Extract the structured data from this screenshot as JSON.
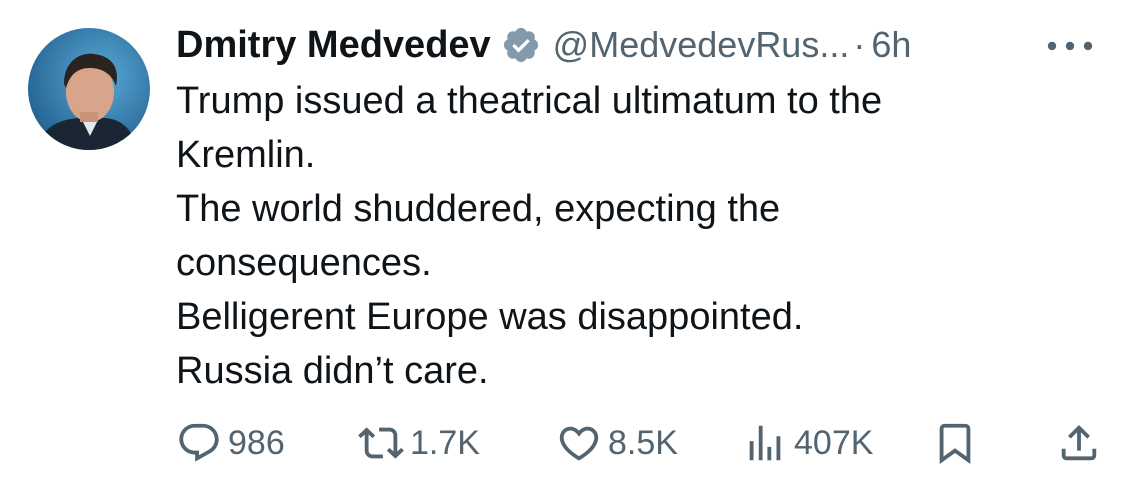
{
  "author": {
    "name": "Dmitry Medvedev",
    "handle": "@MedvedevRus...",
    "separator": "·",
    "time": "6h"
  },
  "tweet": {
    "lines": [
      "Trump issued a theatrical ultimatum to the",
      "Kremlin.",
      "The world shuddered, expecting the",
      "consequences.",
      "Belligerent Europe was disappointed.",
      "Russia didn’t care."
    ]
  },
  "actions": {
    "replies": "986",
    "retweets": "1.7K",
    "likes": "8.5K",
    "views": "407K"
  },
  "icons": {
    "verified": "verified-badge-icon",
    "more": "more-dots-icon",
    "reply": "reply-icon",
    "retweet": "retweet-icon",
    "like": "heart-icon",
    "views": "views-chart-icon",
    "bookmark": "bookmark-icon",
    "share": "share-icon"
  },
  "colors": {
    "text": "#0f1419",
    "secondary": "#536471",
    "verified_badge": "#829aab"
  }
}
